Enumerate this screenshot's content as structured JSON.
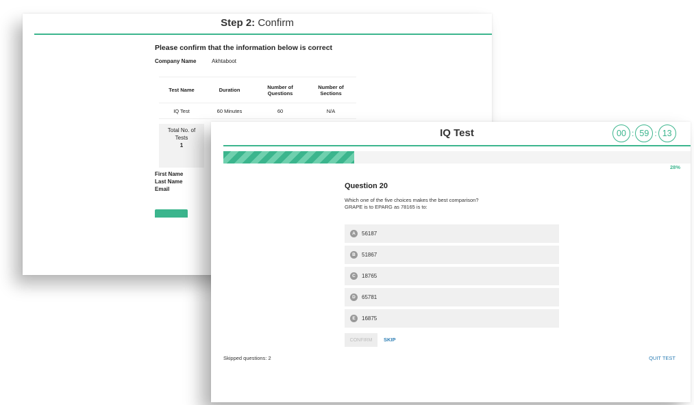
{
  "back_window": {
    "title_bold": "Step 2:",
    "title_rest": " Confirm",
    "heading": "Please confirm that the information below is correct",
    "company_label": "Company Name",
    "company_value": "Akhtaboot",
    "table": {
      "headers": [
        "Test Name",
        "Duration",
        "Number of\nQuestions",
        "Number of\nSections"
      ],
      "row": [
        "IQ Test",
        "60 Minutes",
        "60",
        "N/A"
      ]
    },
    "total_label": "Total No. of Tests",
    "total_value": "1",
    "fields": [
      "First Name",
      "Last Name",
      "Email"
    ],
    "colors": {
      "accent": "#3bb58d"
    }
  },
  "front_window": {
    "title": "IQ Test",
    "timer": {
      "hours": "00",
      "minutes": "59",
      "seconds": "13"
    },
    "progress": {
      "fraction": 0.28,
      "label": "28%"
    },
    "question_title": "Question 20",
    "question_line1": "Which one of the five choices makes the best comparison?",
    "question_line2": "GRAPE is to EPARG as 78165 is to:",
    "choices": [
      {
        "letter": "A",
        "value": "56187"
      },
      {
        "letter": "B",
        "value": "51867"
      },
      {
        "letter": "C",
        "value": "18765"
      },
      {
        "letter": "D",
        "value": "65781"
      },
      {
        "letter": "E",
        "value": "16875"
      }
    ],
    "confirm_label": "CONFIRM",
    "skip_label": "SKIP",
    "skipped_text": "Skipped questions: 2",
    "quit_label": "QUIT TEST",
    "colors": {
      "accent": "#3bb58d",
      "link": "#2f7fb5"
    }
  }
}
